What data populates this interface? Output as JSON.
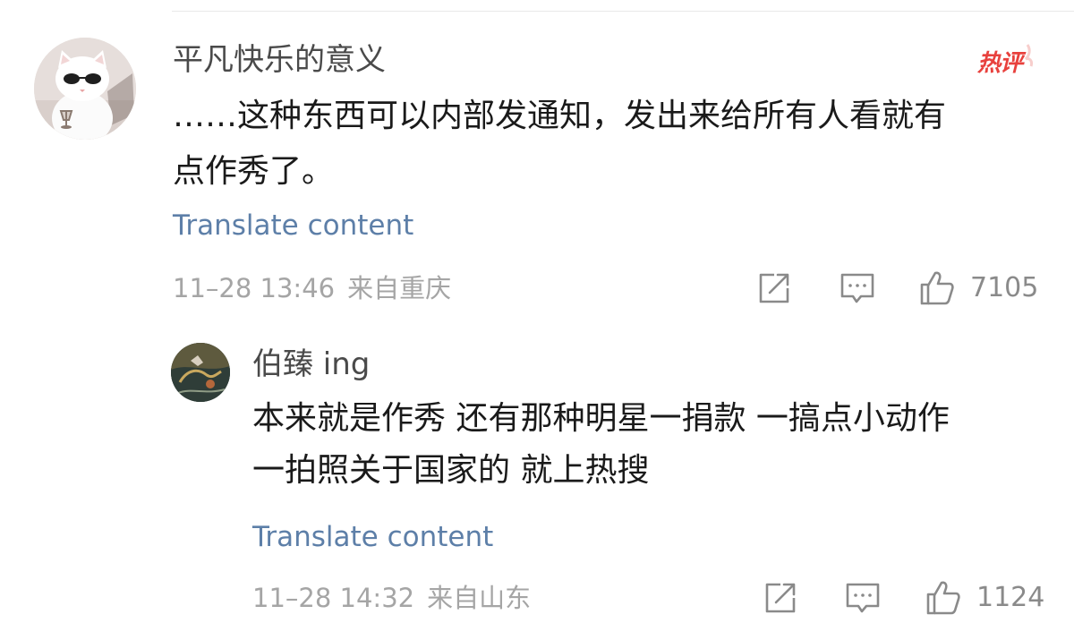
{
  "comment": {
    "username": "平凡快乐的意义",
    "hot_badge": "热评",
    "text_lines": [
      "……这种东西可以内部发通知，发出来给所有人看就有",
      "点作秀了。"
    ],
    "translate": "Translate content",
    "date": "11–28 13:46",
    "location": "来自重庆",
    "likes": "7105",
    "avatar_icon": "white-cat-with-sunglasses-avatar",
    "icons": {
      "share": "share-icon",
      "comment": "comment-icon",
      "like": "thumbs-up-icon"
    }
  },
  "reply": {
    "username": "伯臻 ing",
    "text_lines": [
      "本来就是作秀 还有那种明星一捐款 一搞点小动作",
      "一拍照关于国家的 就上热搜"
    ],
    "translate": "Translate content",
    "date": "11–28 14:32",
    "location": "来自山东",
    "likes": "1124",
    "avatar_icon": "painting-avatar"
  },
  "colors": {
    "link": "#5d7fa8",
    "hot_badge": "#e8413d",
    "meta": "#a5a5a5",
    "icon": "#8a8a8a"
  }
}
